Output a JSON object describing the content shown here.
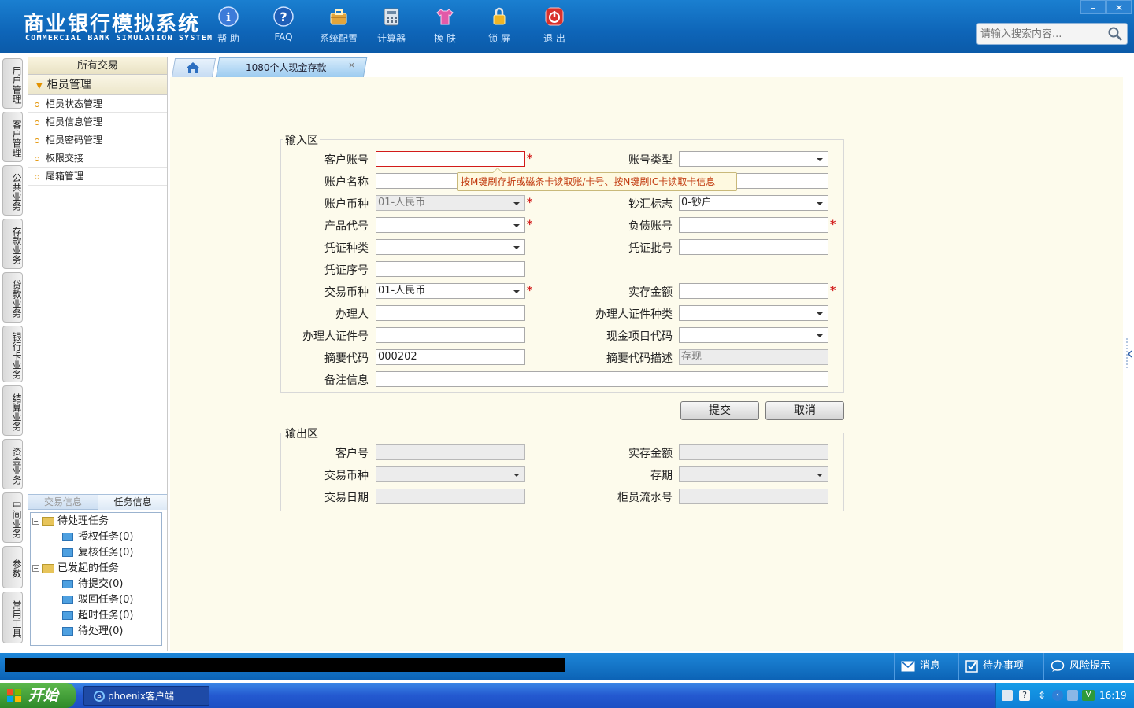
{
  "header": {
    "logo_cn": "商业银行模拟系统",
    "logo_en": "COMMERCIAL BANK SIMULATION SYSTEM",
    "toolbar": [
      {
        "label": "帮 助",
        "icon": "info-icon"
      },
      {
        "label": "FAQ",
        "icon": "faq-icon"
      },
      {
        "label": "系统配置",
        "icon": "toolbox-icon"
      },
      {
        "label": "计算器",
        "icon": "calculator-icon"
      },
      {
        "label": "换 肤",
        "icon": "shirt-icon"
      },
      {
        "label": "锁 屏",
        "icon": "lock-icon"
      },
      {
        "label": "退 出",
        "icon": "power-icon"
      }
    ],
    "search_placeholder": "请输入搜索内容...",
    "window_min": "–",
    "window_close": "✕"
  },
  "vertical_tabs": [
    "用户管理",
    "客户管理",
    "公共业务",
    "存款业务",
    "贷款业务",
    "银行卡业务",
    "结算业务",
    "资金业务",
    "中间业务",
    "参数",
    "常用工具"
  ],
  "left_panel": {
    "header": "所有交易",
    "group": "柜员管理",
    "items": [
      "柜员状态管理",
      "柜员信息管理",
      "柜员密码管理",
      "权限交接",
      "尾箱管理"
    ],
    "task_tabs": [
      "交易信息",
      "任务信息"
    ],
    "tree": {
      "pending": "待处理任务",
      "pending_children": [
        "授权任务(0)",
        "复核任务(0)"
      ],
      "initiated": "已发起的任务",
      "initiated_children": [
        "待提交(0)",
        "驳回任务(0)",
        "超时任务(0)",
        "待处理(0)"
      ]
    }
  },
  "tabs": {
    "active": "1080个人现金存款",
    "close": "×"
  },
  "form": {
    "input_legend": "输入区",
    "output_legend": "输出区",
    "fields": {
      "customer_account": {
        "label": "客户账号",
        "value": ""
      },
      "account_type": {
        "label": "账号类型",
        "value": ""
      },
      "account_name": {
        "label": "账户名称",
        "value": ""
      },
      "account_currency": {
        "label": "账户币种",
        "value": "01-人民币"
      },
      "cash_flag": {
        "label": "钞汇标志",
        "value": "0-钞户"
      },
      "product_code": {
        "label": "产品代号",
        "value": ""
      },
      "liability_account": {
        "label": "负债账号",
        "value": ""
      },
      "voucher_type": {
        "label": "凭证种类",
        "value": ""
      },
      "voucher_batch": {
        "label": "凭证批号",
        "value": ""
      },
      "voucher_serial": {
        "label": "凭证序号",
        "value": ""
      },
      "trade_currency": {
        "label": "交易币种",
        "value": "01-人民币"
      },
      "actual_amount": {
        "label": "实存金额",
        "value": ""
      },
      "agent": {
        "label": "办理人",
        "value": ""
      },
      "agent_id_type": {
        "label": "办理人证件种类",
        "value": ""
      },
      "agent_id_no": {
        "label": "办理人证件号",
        "value": ""
      },
      "cash_item_code": {
        "label": "现金项目代码",
        "value": ""
      },
      "summary_code": {
        "label": "摘要代码",
        "value": "000202"
      },
      "summary_desc": {
        "label": "摘要代码描述",
        "value": "存现"
      },
      "remarks": {
        "label": "备注信息",
        "value": ""
      }
    },
    "tooltip": "按M键刷存折或磁条卡读取账/卡号、按N键刷IC卡读取卡信息",
    "submit": "提交",
    "cancel": "取消",
    "output": {
      "customer_no": {
        "label": "客户号",
        "value": ""
      },
      "actual_amount": {
        "label": "实存金额",
        "value": ""
      },
      "trade_currency": {
        "label": "交易币种",
        "value": ""
      },
      "term": {
        "label": "存期",
        "value": ""
      },
      "trade_date": {
        "label": "交易日期",
        "value": ""
      },
      "teller_serial": {
        "label": "柜员流水号",
        "value": ""
      }
    }
  },
  "statusbar": {
    "message": "消息",
    "todo": "待办事项",
    "risk": "风险提示"
  },
  "taskbar": {
    "start": "开始",
    "task": "phoenix客户端",
    "clock": "16:19"
  },
  "colors": {
    "header_blue": "#0e65b8",
    "content_bg": "#fdfbec",
    "required_red": "#d21a1a"
  }
}
